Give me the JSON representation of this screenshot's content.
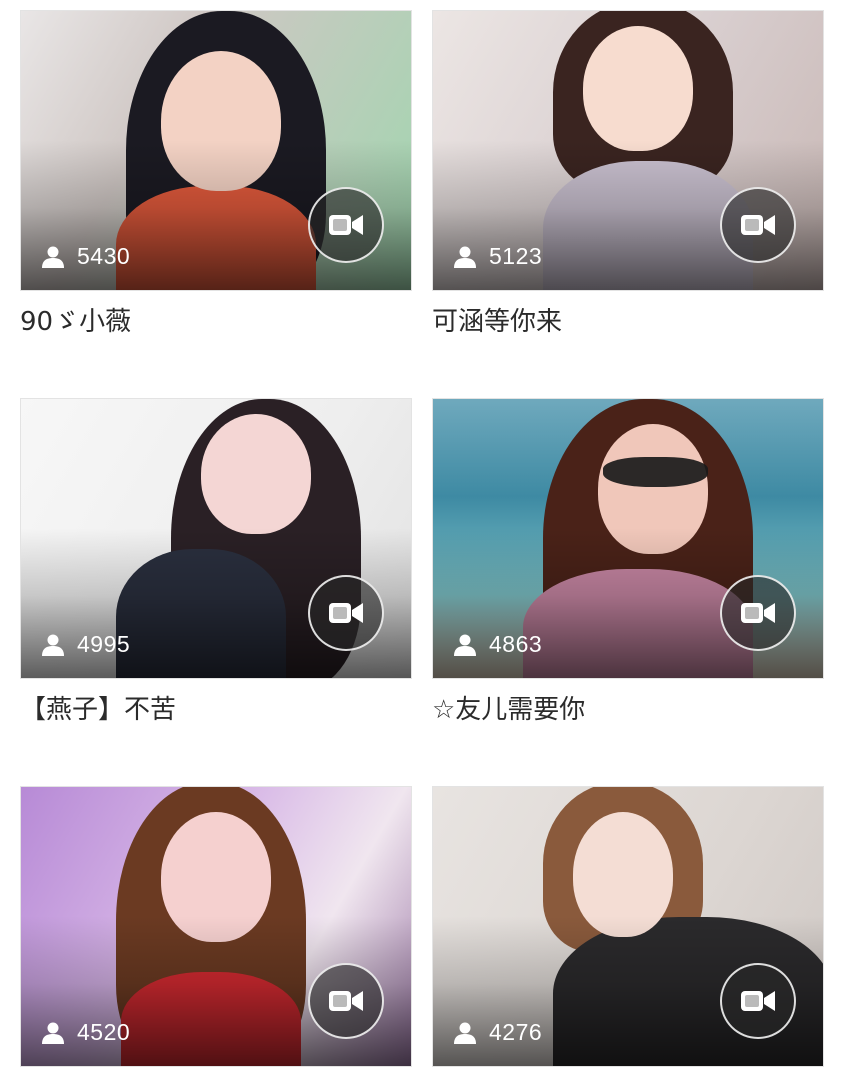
{
  "streams": [
    {
      "title": "90ゞ小薇",
      "viewers": "5430",
      "bg": "linear-gradient(120deg,#e9e6e6 0%,#cfc7c4 35%,#9fd6ae 100%)",
      "hair": "#1b1a22",
      "skin": "#f3d2c4",
      "cloth": "#e25a3c"
    },
    {
      "title": "可涵等你来",
      "viewers": "5123",
      "bg": "linear-gradient(120deg,#ece6e4 0%,#d9cfd0 50%,#c8b7b4 100%)",
      "hair": "#3a2420",
      "skin": "#f7dccf",
      "cloth": "#c9c0cf"
    },
    {
      "title": "【燕子】不苦",
      "viewers": "4995",
      "bg": "linear-gradient(120deg,#f7f7f7 0%,#eeeeee 60%,#e2e2e2 100%)",
      "hair": "#2a2025",
      "skin": "#f4d6d4",
      "cloth": "#2a2f3e"
    },
    {
      "title": "☆友儿需要你",
      "viewers": "4863",
      "bg": "linear-gradient(180deg,#6fa9bd 0%,#3e8aa3 35%,#7cc1c6 70%,#d8cbb8 100%)",
      "hair": "#4a2218",
      "skin": "#f0c7ba",
      "cloth": "#c786a3"
    },
    {
      "title": "",
      "viewers": "4520",
      "bg": "linear-gradient(120deg,#b78ad6 0%,#d6b5e6 40%,#f0e6ef 70%,#9d7aa7 100%)",
      "hair": "#6b3a22",
      "skin": "#f5d0cf",
      "cloth": "#d42a31"
    },
    {
      "title": "",
      "viewers": "4276",
      "bg": "linear-gradient(120deg,#e8e4e1 0%,#dcd6d2 60%,#cfc8c4 100%)",
      "hair": "#8a5a3c",
      "skin": "#f4ddd4",
      "cloth": "#2b2a2c"
    }
  ],
  "icons": {
    "viewer": "user-icon",
    "video": "video-camera-icon"
  }
}
